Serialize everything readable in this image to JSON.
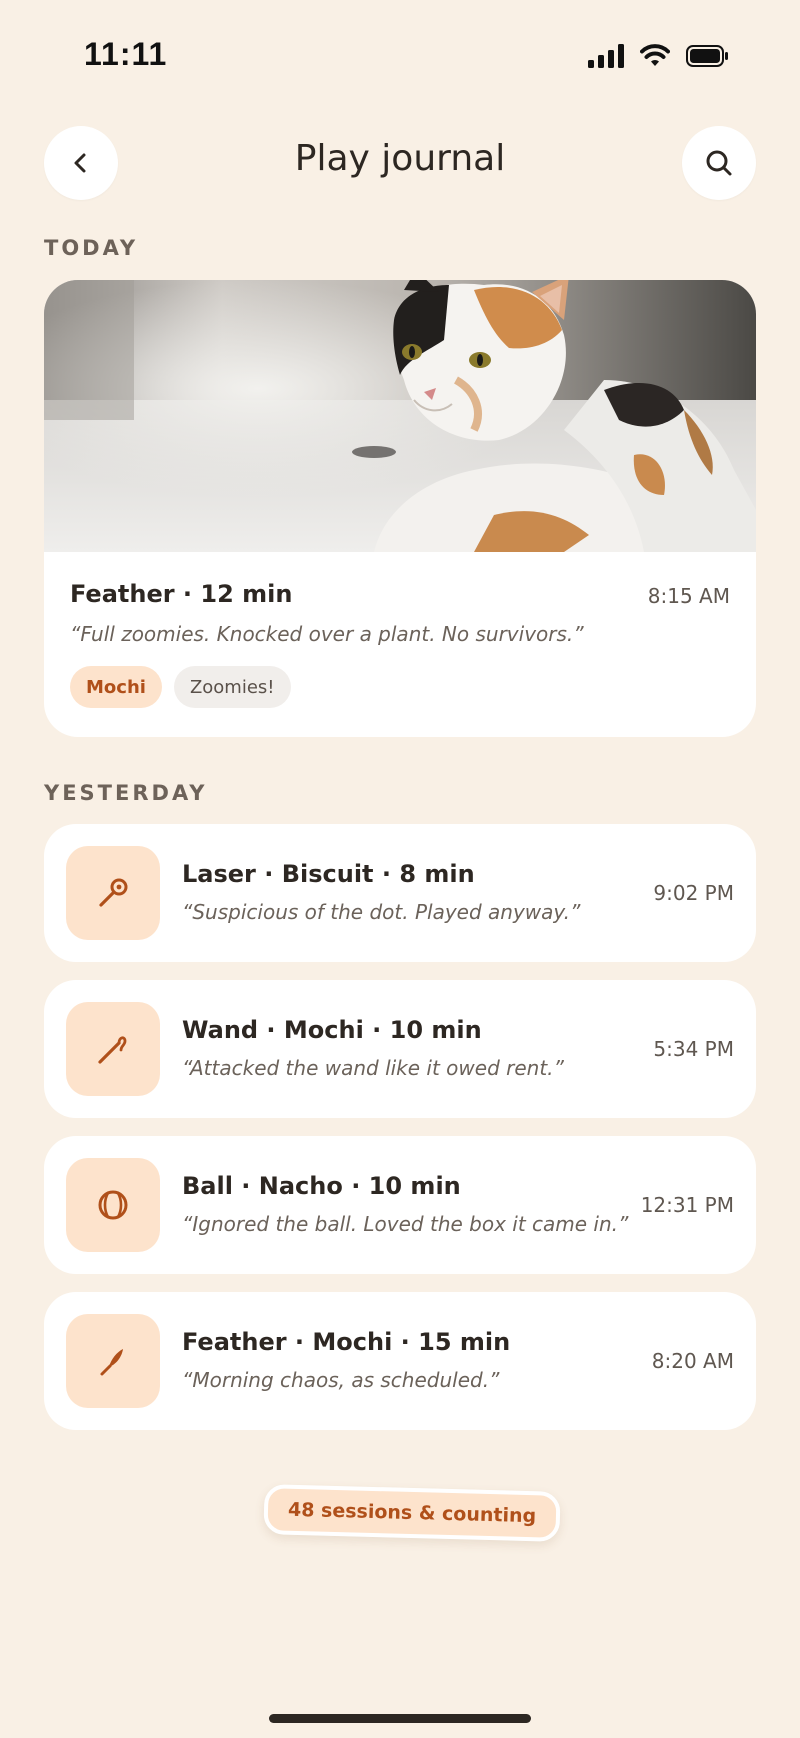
{
  "status": {
    "time": "11:11"
  },
  "header": {
    "title": "Play journal",
    "back_icon": "chevron-left-icon",
    "search_icon": "search-icon"
  },
  "today": {
    "label": "TODAY",
    "entry": {
      "title": "Feather · 12 min",
      "time": "8:15 AM",
      "note": "“Full zoomies. Knocked over a plant. No survivors.”",
      "cat_chip": "Mochi",
      "tag_chip": "Zoomies!"
    }
  },
  "yesterday": {
    "label": "YESTERDAY",
    "entries": [
      {
        "title": "Laser · Biscuit · 8 min",
        "note": "“Suspicious of the dot. Played anyway.”",
        "time": "9:02 PM",
        "icon": "laser-pointer-icon"
      },
      {
        "title": "Wand · Mochi · 10 min",
        "note": "“Attacked the wand like it owed rent.”",
        "time": "5:34 PM",
        "icon": "wand-toy-icon"
      },
      {
        "title": "Ball · Nacho · 10 min",
        "note": "“Ignored the ball. Loved the box it came in.”",
        "time": "12:31 PM",
        "icon": "ball-icon"
      },
      {
        "title": "Feather · Mochi · 15 min",
        "note": "“Morning chaos, as scheduled.”",
        "time": "8:20 AM",
        "icon": "feather-icon"
      }
    ]
  },
  "footer": {
    "counter": "48 sessions & counting"
  },
  "colors": {
    "background": "#f9f0e5",
    "accent": "#b0501a",
    "accent_soft": "#fde3cc",
    "card": "#ffffff"
  }
}
